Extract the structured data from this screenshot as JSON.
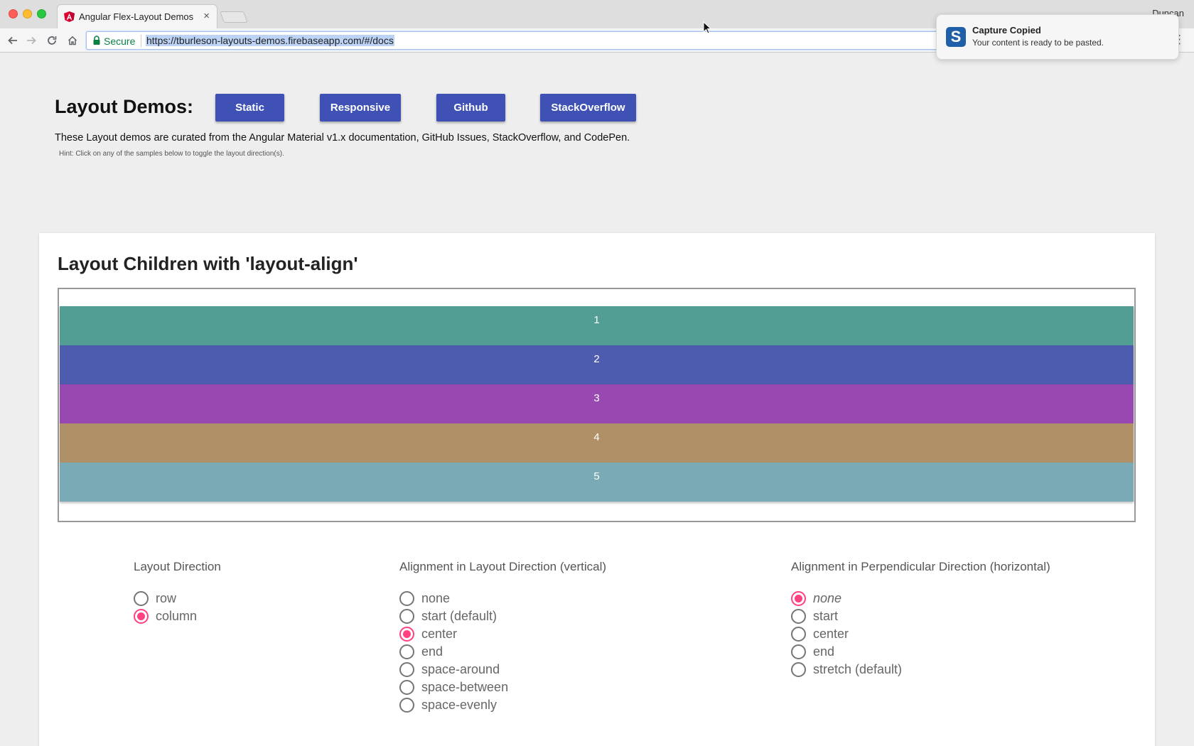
{
  "browser": {
    "tab_title": "Angular Flex-Layout Demos",
    "tab_close": "×",
    "profile_name": "Duncan",
    "secure_label": "Secure",
    "url": "https://tburleson-layouts-demos.firebaseapp.com/#/docs"
  },
  "notification": {
    "title": "Capture Copied",
    "message": "Your content is ready to be pasted.",
    "icon_letter": "S"
  },
  "header": {
    "title": "Layout Demos:",
    "buttons": [
      "Static",
      "Responsive",
      "Github",
      "StackOverflow"
    ],
    "intro": "These Layout demos are curated from the Angular Material v1.x documentation, GitHub Issues, StackOverflow, and CodePen.",
    "hint": "Hint: Click on any of the samples below to toggle the layout direction(s)."
  },
  "card": {
    "title": "Layout Children with 'layout-align'",
    "blocks": [
      {
        "label": "1",
        "color": "#539e94"
      },
      {
        "label": "2",
        "color": "#4d5cae"
      },
      {
        "label": "3",
        "color": "#9848b1"
      },
      {
        "label": "4",
        "color": "#b09066"
      },
      {
        "label": "5",
        "color": "#7aaab5"
      }
    ]
  },
  "controls": {
    "direction": {
      "title": "Layout Direction",
      "options": [
        "row",
        "column"
      ],
      "selected": "column"
    },
    "main_axis": {
      "title": "Alignment in Layout Direction (vertical)",
      "options": [
        "none",
        "start (default)",
        "center",
        "end",
        "space-around",
        "space-between",
        "space-evenly"
      ],
      "selected": "center"
    },
    "cross_axis": {
      "title": "Alignment in Perpendicular Direction (horizontal)",
      "options": [
        "none",
        "start",
        "center",
        "end",
        "stretch (default)"
      ],
      "selected": "none"
    }
  },
  "colors": {
    "primary": "#3f51b5",
    "accent": "#ff4081"
  }
}
